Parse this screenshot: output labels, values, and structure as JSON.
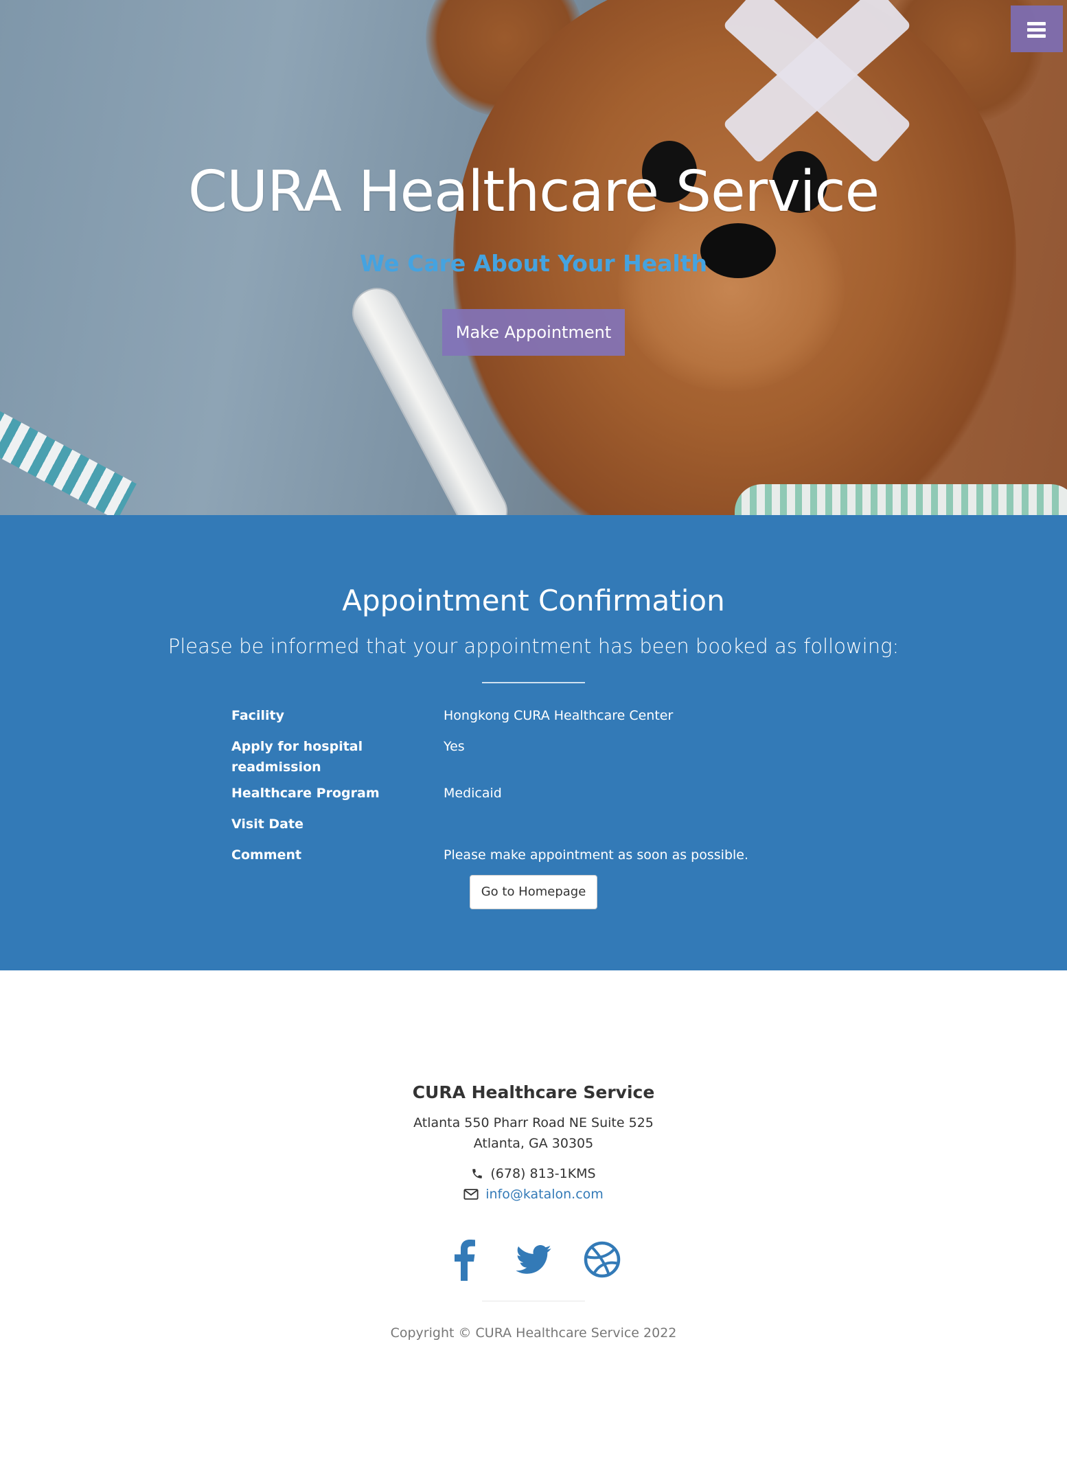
{
  "hero": {
    "title": "CURA Healthcare Service",
    "subtitle": "We Care About Your Health",
    "cta_label": "Make Appointment",
    "menu_icon": "bars-icon"
  },
  "confirmation": {
    "title": "Appointment Confirmation",
    "lead": "Please be informed that your appointment has been booked as following:",
    "details": [
      {
        "label": "Facility",
        "value": "Hongkong CURA Healthcare Center"
      },
      {
        "label": "Apply for hospital readmission",
        "value": "Yes"
      },
      {
        "label": "Healthcare Program",
        "value": "Medicaid"
      },
      {
        "label": "Visit Date",
        "value": ""
      },
      {
        "label": "Comment",
        "value": "Please make appointment as soon as possible."
      }
    ],
    "home_button_label": "Go to Homepage"
  },
  "footer": {
    "title": "CURA Healthcare Service",
    "address_line1": "Atlanta 550 Pharr Road NE Suite 525",
    "address_line2": "Atlanta, GA 30305",
    "phone": "(678) 813-1KMS",
    "email": "info@katalon.com",
    "social": [
      "facebook-icon",
      "twitter-icon",
      "dribbble-icon"
    ],
    "copyright": "Copyright © CURA Healthcare Service 2022"
  },
  "colors": {
    "primary": "#337ab7",
    "accent_purple": "#8273b9",
    "subtitle_blue": "#45a3e0"
  }
}
